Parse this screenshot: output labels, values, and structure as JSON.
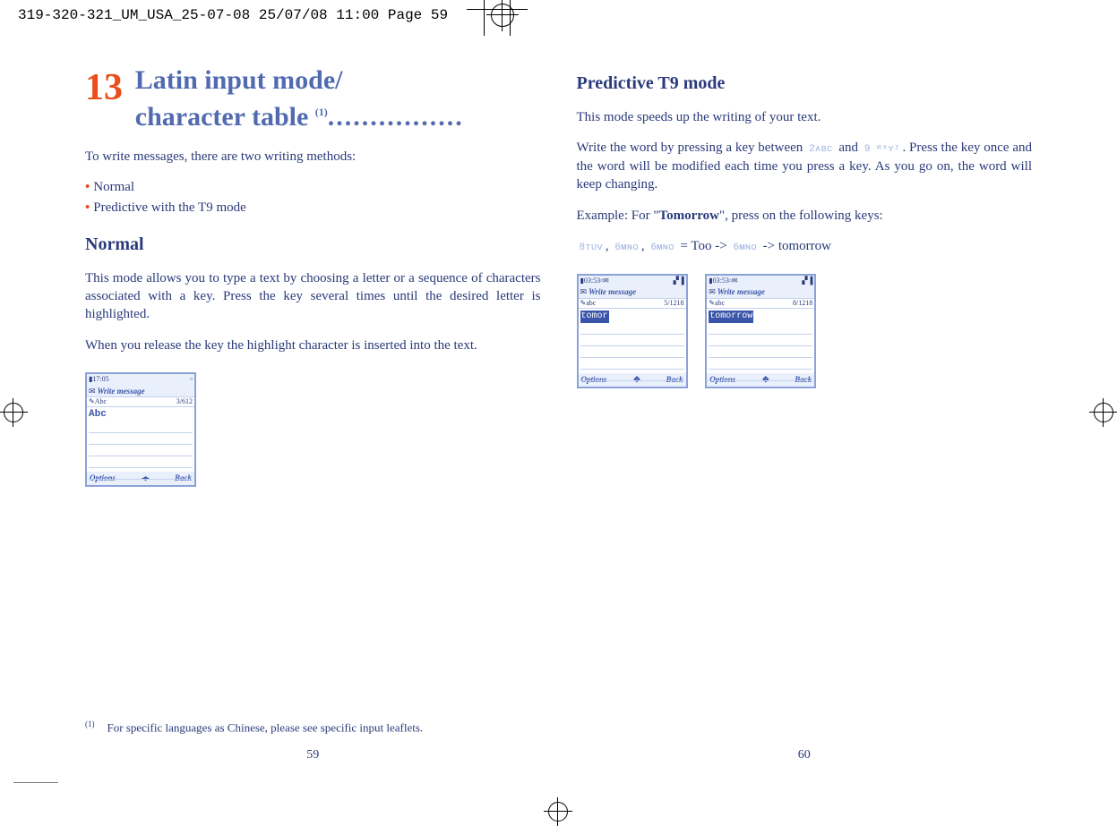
{
  "crop_header": "319-320-321_UM_USA_25-07-08  25/07/08  11:00  Page 59",
  "left_page": {
    "chapter_number": "13",
    "chapter_title_line1": "Latin input mode/",
    "chapter_title_line2": "character table ",
    "chapter_title_sup": "(1)",
    "chapter_dots": "................",
    "intro": "To write messages, there are two writing methods:",
    "bullet1": "Normal",
    "bullet2": "Predictive with the T9 mode",
    "section": "Normal",
    "para1": "This mode allows you to type a text by choosing a letter or a sequence of characters associated with a key. Press the key several times until the desired letter is highlighted.",
    "para2": "When you release the key the highlight character is inserted into the text.",
    "footnote_marker": "(1)",
    "footnote_text": "For specific languages as Chinese, please see specific input leaflets.",
    "page_number": "59"
  },
  "right_page": {
    "section": "Predictive T9 mode",
    "para1": "This mode speeds up the writing of your text.",
    "para2a": "Write the word by pressing a key between ",
    "para2b": " and ",
    "para2c": ". Press the key once and the word will be modified each time you press a key. As you go on, the word will keep changing.",
    "example_label": "Example: For \"",
    "example_word": "Tomorrow",
    "example_label2": "\", press on the following keys:",
    "seq_part1": "= Too ->",
    "seq_part2": "-> tomorrow",
    "page_number": "60"
  },
  "keys": {
    "k2": "2ᴀʙᴄ",
    "k9": "9 ʷˣʏᶻ",
    "k8": "8ᴛᴜᴠ",
    "k6": "6ᴍɴᴏ"
  },
  "phone_normal": {
    "time": "17:05",
    "title": "Write message",
    "mode": "Abc",
    "counter": "3/612",
    "typed": "Abc",
    "left": "Options",
    "right": "Back"
  },
  "phone_t9a": {
    "time": "03:53",
    "title": "Write message",
    "mode": "abc",
    "counter": "5/1218",
    "typed": "tomor",
    "left": "Options",
    "right": "Back"
  },
  "phone_t9b": {
    "time": "03:53",
    "title": "Write message",
    "mode": "abc",
    "counter": "8/1218",
    "typed": "tomorrow",
    "left": "Options",
    "right": "Back"
  }
}
